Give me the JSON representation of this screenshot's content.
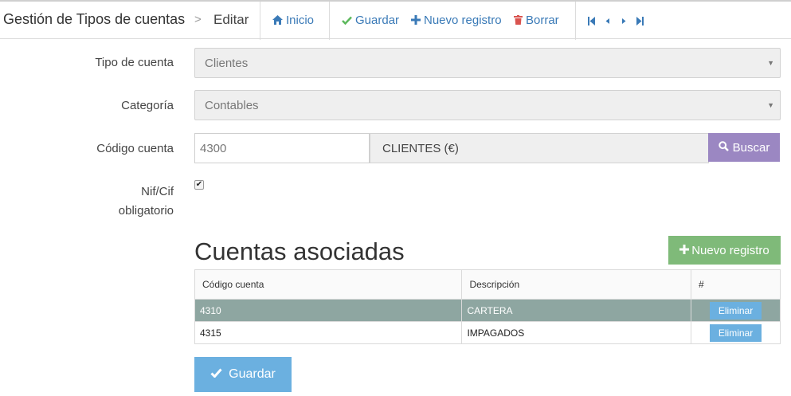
{
  "header": {
    "title": "Gestión de Tipos de cuentas",
    "separator": ">",
    "mode": "Editar",
    "buttons": {
      "inicio": "Inicio",
      "guardar": "Guardar",
      "nuevo": "Nuevo registro",
      "borrar": "Borrar"
    }
  },
  "form": {
    "tipo_cuenta": {
      "label": "Tipo de cuenta",
      "value": "Clientes"
    },
    "categoria": {
      "label": "Categoría",
      "value": "Contables"
    },
    "codigo_cuenta": {
      "label": "Código cuenta",
      "value": "4300",
      "description": "CLIENTES (€)",
      "search_label": "Buscar"
    },
    "nif": {
      "label_line1": "Nif/Cif",
      "label_line2": "obligatorio",
      "checked": true
    }
  },
  "section": {
    "title": "Cuentas asociadas",
    "new_button": "Nuevo registro"
  },
  "table": {
    "headers": [
      "Código cuenta",
      "Descripción",
      "#"
    ],
    "rows": [
      {
        "codigo": "4310",
        "descripcion": "CARTERA",
        "action": "Eliminar"
      },
      {
        "codigo": "4315",
        "descripcion": "IMPAGADOS",
        "action": "Eliminar"
      }
    ]
  },
  "footer": {
    "save_label": "Guardar"
  },
  "colors": {
    "link": "#3a7ab7",
    "buscar": "#9b87c2",
    "nuevo": "#7fba79",
    "primary": "#6bb0e0",
    "selected_row": "#8ea6a1"
  }
}
